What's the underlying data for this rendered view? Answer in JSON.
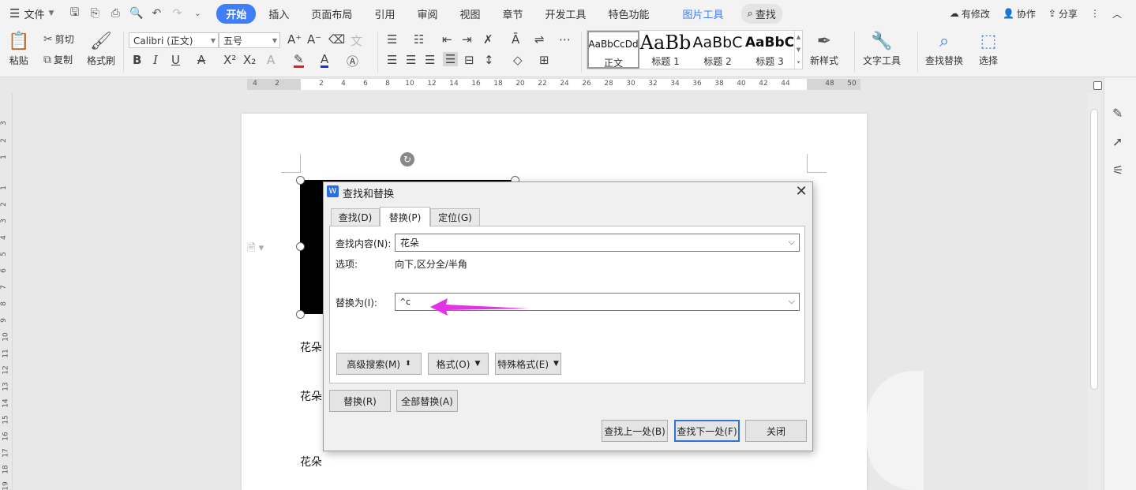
{
  "menu": {
    "file": "文件",
    "tabs": [
      "开始",
      "插入",
      "页面布局",
      "引用",
      "审阅",
      "视图",
      "章节",
      "开发工具",
      "特色功能"
    ],
    "picture_tool": "图片工具",
    "search": "查找",
    "right": {
      "modified": "有修改",
      "collab": "协作",
      "share": "分享"
    }
  },
  "ribbon": {
    "paste": "粘贴",
    "cut": "剪切",
    "copy": "复制",
    "format_painter": "格式刷",
    "font_name": "Calibri (正文)",
    "font_size": "五号",
    "styles": [
      {
        "preview": "AaBbCcDd",
        "name": "正文"
      },
      {
        "preview": "AaBb",
        "name": "标题 1"
      },
      {
        "preview": "AaBbC",
        "name": "标题 2"
      },
      {
        "preview": "AaBbC",
        "name": "标题 3"
      }
    ],
    "new_style": "新样式",
    "text_tools": "文字工具",
    "find_replace": "查找替换",
    "select": "选择"
  },
  "ruler": {
    "ticks": [
      "4",
      "2",
      "2",
      "4",
      "6",
      "8",
      "10",
      "12",
      "14",
      "16",
      "18",
      "20",
      "22",
      "24",
      "26",
      "28",
      "30",
      "32",
      "34",
      "36",
      "38",
      "40",
      "42",
      "44",
      "48",
      "50"
    ],
    "vticks": [
      "3",
      "2",
      "1",
      "1",
      "2",
      "3",
      "4",
      "5",
      "6",
      "7",
      "8",
      "9",
      "10",
      "11",
      "12",
      "13",
      "14",
      "15",
      "16",
      "17",
      "18",
      "19"
    ]
  },
  "document": {
    "lines": [
      "花朵",
      "花朵",
      "花朵"
    ]
  },
  "dialog": {
    "title": "查找和替换",
    "tabs": [
      "查找(D)",
      "替换(P)",
      "定位(G)"
    ],
    "active_tab": 1,
    "find_label": "查找内容(N):",
    "find_value": "花朵",
    "options_label": "选项:",
    "options_value": "向下,区分全/半角",
    "replace_label": "替换为(I):",
    "replace_value": "^c",
    "advanced_search": "高级搜索(M)",
    "format": "格式(O)",
    "special_format": "特殊格式(E)",
    "replace": "替换(R)",
    "replace_all": "全部替换(A)",
    "find_prev": "查找上一处(B)",
    "find_next": "查找下一处(F)",
    "close": "关闭"
  },
  "colors": {
    "accent": "#3f7ef6",
    "annotation_arrow": "#e233e6"
  }
}
